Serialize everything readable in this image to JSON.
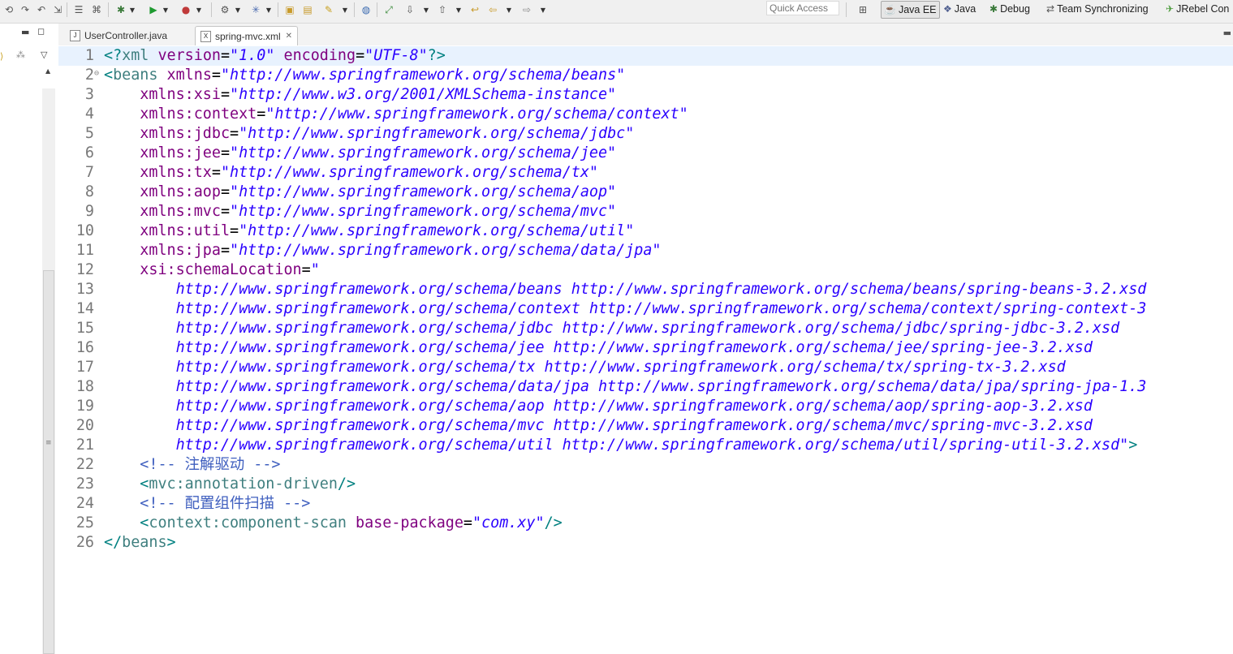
{
  "toolbar": {
    "quick_access_placeholder": "Quick Access",
    "perspectives": [
      {
        "label": "Java EE",
        "icon": "java-ee-perspective-icon"
      },
      {
        "label": "Java",
        "icon": "java-perspective-icon"
      },
      {
        "label": "Debug",
        "icon": "debug-perspective-icon"
      },
      {
        "label": "Team Synchronizing",
        "icon": "team-sync-perspective-icon"
      },
      {
        "label": "JRebel Con",
        "icon": "jrebel-perspective-icon"
      }
    ]
  },
  "tabs": [
    {
      "label": "UserController.java",
      "icon": "java-file-icon"
    },
    {
      "label": "spring-mvc.xml",
      "icon": "xml-file-icon",
      "active": true
    }
  ],
  "editor": {
    "lines": [
      {
        "num": "1",
        "tokens": [
          [
            "t-punct",
            "<?"
          ],
          [
            "t-tag",
            "xml"
          ],
          [
            "t-text",
            " "
          ],
          [
            "t-attr",
            "version"
          ],
          [
            "t-text",
            "="
          ],
          [
            "t-str",
            "\"1.0\""
          ],
          [
            "t-text",
            " "
          ],
          [
            "t-attr",
            "encoding"
          ],
          [
            "t-text",
            "="
          ],
          [
            "t-str",
            "\"UTF-8\""
          ],
          [
            "t-punct",
            "?>"
          ]
        ]
      },
      {
        "num": "2",
        "fold": "⊖",
        "tokens": [
          [
            "t-punct",
            "<"
          ],
          [
            "t-tag",
            "beans"
          ],
          [
            "t-text",
            " "
          ],
          [
            "t-attr",
            "xmlns"
          ],
          [
            "t-text",
            "="
          ],
          [
            "t-str",
            "\"http://www.springframework.org/schema/beans\""
          ]
        ]
      },
      {
        "num": "3",
        "tokens": [
          [
            "t-text",
            "    "
          ],
          [
            "t-attr",
            "xmlns:xsi"
          ],
          [
            "t-text",
            "="
          ],
          [
            "t-str",
            "\"http://www.w3.org/2001/XMLSchema-instance\""
          ]
        ]
      },
      {
        "num": "4",
        "tokens": [
          [
            "t-text",
            "    "
          ],
          [
            "t-attr",
            "xmlns:context"
          ],
          [
            "t-text",
            "="
          ],
          [
            "t-str",
            "\"http://www.springframework.org/schema/context\""
          ]
        ]
      },
      {
        "num": "5",
        "tokens": [
          [
            "t-text",
            "    "
          ],
          [
            "t-attr",
            "xmlns:jdbc"
          ],
          [
            "t-text",
            "="
          ],
          [
            "t-str",
            "\"http://www.springframework.org/schema/jdbc\""
          ]
        ]
      },
      {
        "num": "6",
        "tokens": [
          [
            "t-text",
            "    "
          ],
          [
            "t-attr",
            "xmlns:jee"
          ],
          [
            "t-text",
            "="
          ],
          [
            "t-str",
            "\"http://www.springframework.org/schema/jee\""
          ]
        ]
      },
      {
        "num": "7",
        "tokens": [
          [
            "t-text",
            "    "
          ],
          [
            "t-attr",
            "xmlns:tx"
          ],
          [
            "t-text",
            "="
          ],
          [
            "t-str",
            "\"http://www.springframework.org/schema/tx\""
          ]
        ]
      },
      {
        "num": "8",
        "tokens": [
          [
            "t-text",
            "    "
          ],
          [
            "t-attr",
            "xmlns:aop"
          ],
          [
            "t-text",
            "="
          ],
          [
            "t-str",
            "\"http://www.springframework.org/schema/aop\""
          ]
        ]
      },
      {
        "num": "9",
        "tokens": [
          [
            "t-text",
            "    "
          ],
          [
            "t-attr",
            "xmlns:mvc"
          ],
          [
            "t-text",
            "="
          ],
          [
            "t-str",
            "\"http://www.springframework.org/schema/mvc\""
          ]
        ]
      },
      {
        "num": "10",
        "tokens": [
          [
            "t-text",
            "    "
          ],
          [
            "t-attr",
            "xmlns:util"
          ],
          [
            "t-text",
            "="
          ],
          [
            "t-str",
            "\"http://www.springframework.org/schema/util\""
          ]
        ]
      },
      {
        "num": "11",
        "tokens": [
          [
            "t-text",
            "    "
          ],
          [
            "t-attr",
            "xmlns:jpa"
          ],
          [
            "t-text",
            "="
          ],
          [
            "t-str",
            "\"http://www.springframework.org/schema/data/jpa\""
          ]
        ]
      },
      {
        "num": "12",
        "tokens": [
          [
            "t-text",
            "    "
          ],
          [
            "t-attr",
            "xsi:schemaLocation"
          ],
          [
            "t-text",
            "="
          ],
          [
            "t-str",
            "\""
          ]
        ]
      },
      {
        "num": "13",
        "tokens": [
          [
            "t-str",
            "        http://www.springframework.org/schema/beans http://www.springframework.org/schema/beans/spring-beans-3.2.xsd"
          ]
        ]
      },
      {
        "num": "14",
        "tokens": [
          [
            "t-str",
            "        http://www.springframework.org/schema/context http://www.springframework.org/schema/context/spring-context-3"
          ]
        ]
      },
      {
        "num": "15",
        "tokens": [
          [
            "t-str",
            "        http://www.springframework.org/schema/jdbc http://www.springframework.org/schema/jdbc/spring-jdbc-3.2.xsd"
          ]
        ]
      },
      {
        "num": "16",
        "tokens": [
          [
            "t-str",
            "        http://www.springframework.org/schema/jee http://www.springframework.org/schema/jee/spring-jee-3.2.xsd"
          ]
        ]
      },
      {
        "num": "17",
        "tokens": [
          [
            "t-str",
            "        http://www.springframework.org/schema/tx http://www.springframework.org/schema/tx/spring-tx-3.2.xsd"
          ]
        ]
      },
      {
        "num": "18",
        "tokens": [
          [
            "t-str",
            "        http://www.springframework.org/schema/data/jpa http://www.springframework.org/schema/data/jpa/spring-jpa-1.3"
          ]
        ]
      },
      {
        "num": "19",
        "tokens": [
          [
            "t-str",
            "        http://www.springframework.org/schema/aop http://www.springframework.org/schema/aop/spring-aop-3.2.xsd"
          ]
        ]
      },
      {
        "num": "20",
        "tokens": [
          [
            "t-str",
            "        http://www.springframework.org/schema/mvc http://www.springframework.org/schema/mvc/spring-mvc-3.2.xsd"
          ]
        ]
      },
      {
        "num": "21",
        "tokens": [
          [
            "t-str",
            "        http://www.springframework.org/schema/util http://www.springframework.org/schema/util/spring-util-3.2.xsd\""
          ],
          [
            "t-punct",
            ">"
          ]
        ]
      },
      {
        "num": "22",
        "tokens": [
          [
            "t-text",
            "    "
          ],
          [
            "t-comment",
            "<!-- 注解驱动 -->"
          ]
        ]
      },
      {
        "num": "23",
        "tokens": [
          [
            "t-text",
            "    "
          ],
          [
            "t-punct",
            "<"
          ],
          [
            "t-tag",
            "mvc:annotation-driven"
          ],
          [
            "t-punct",
            "/>"
          ]
        ]
      },
      {
        "num": "24",
        "tokens": [
          [
            "t-text",
            "    "
          ],
          [
            "t-comment",
            "<!-- 配置组件扫描 -->"
          ]
        ]
      },
      {
        "num": "25",
        "tokens": [
          [
            "t-text",
            "    "
          ],
          [
            "t-punct",
            "<"
          ],
          [
            "t-tag",
            "context:component-scan"
          ],
          [
            "t-text",
            " "
          ],
          [
            "t-attr",
            "base-package"
          ],
          [
            "t-text",
            "="
          ],
          [
            "t-str",
            "\"com.xy\""
          ],
          [
            "t-punct",
            "/>"
          ]
        ]
      },
      {
        "num": "26",
        "tokens": [
          [
            "t-punct",
            "</"
          ],
          [
            "t-tag",
            "beans"
          ],
          [
            "t-punct",
            ">"
          ]
        ]
      }
    ]
  }
}
